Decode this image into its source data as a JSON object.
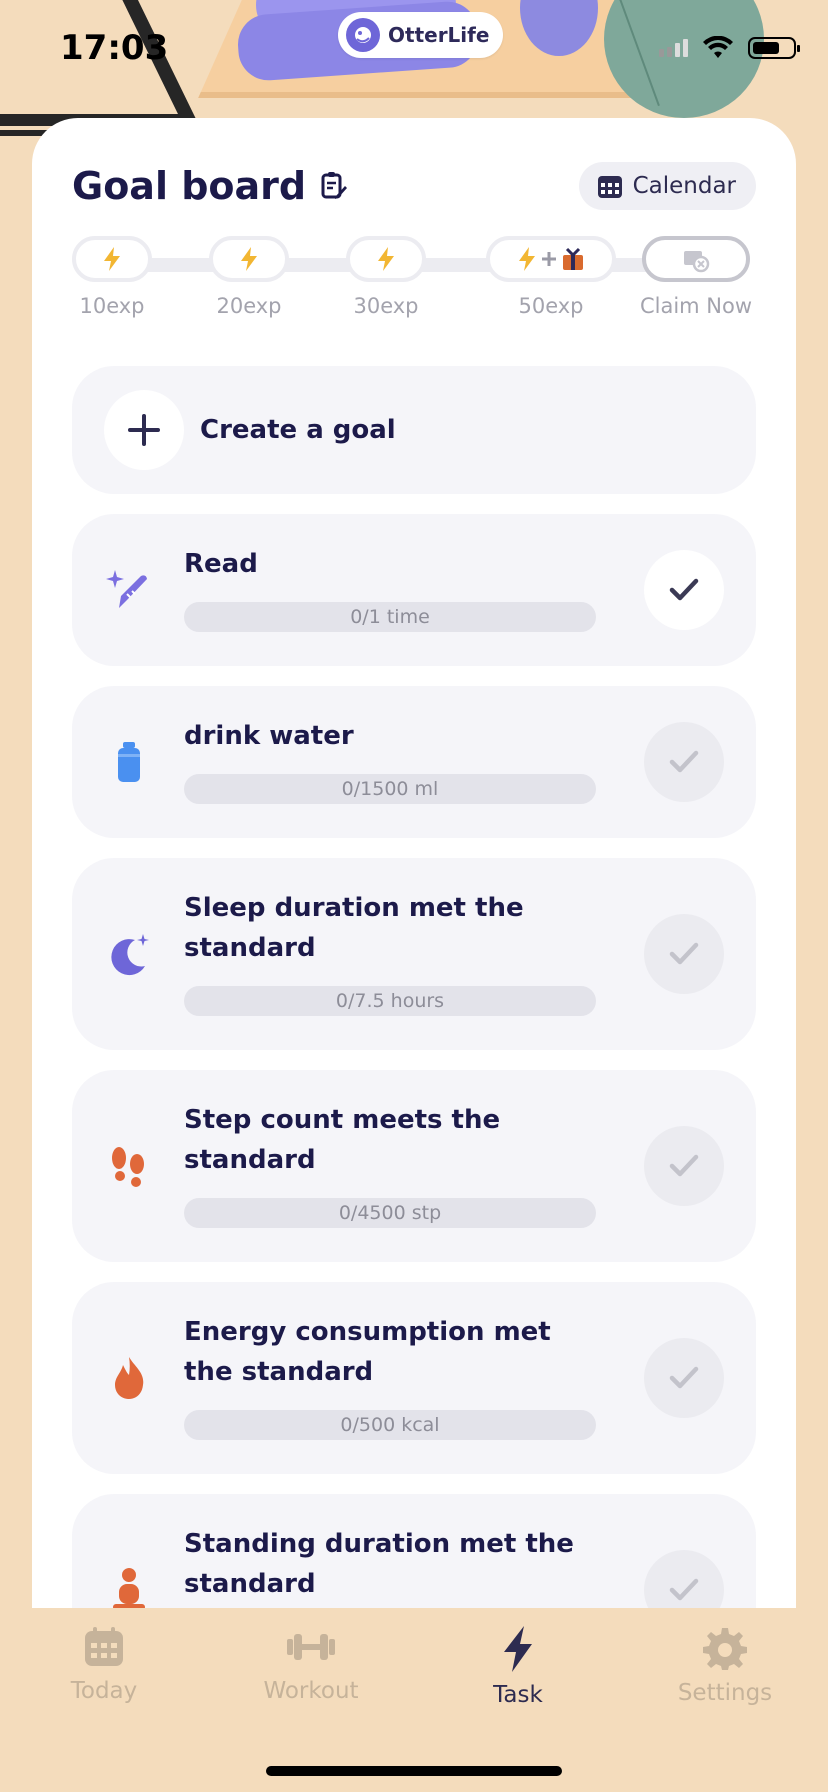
{
  "status_bar": {
    "time": "17:03"
  },
  "brand": {
    "name": "OtterLife"
  },
  "header": {
    "title": "Goal board",
    "calendar_label": "Calendar"
  },
  "exp_track": {
    "milestones": [
      {
        "label": "10exp"
      },
      {
        "label": "20exp"
      },
      {
        "label": "30exp"
      },
      {
        "label": "50exp"
      }
    ],
    "claim_label": "Claim Now"
  },
  "create_goal": {
    "label": "Create a goal"
  },
  "goals": [
    {
      "name": "Read",
      "progress": "0/1 time",
      "done": true,
      "icon": "pen-sparkle-icon"
    },
    {
      "name": "drink water",
      "progress": "0/1500 ml",
      "done": false,
      "icon": "water-bottle-icon"
    },
    {
      "name": "Sleep duration met the standard",
      "progress": "0/7.5 hours",
      "done": false,
      "icon": "moon-icon"
    },
    {
      "name": "Step count meets the standard",
      "progress": "0/4500 stp",
      "done": false,
      "icon": "footprints-icon"
    },
    {
      "name": "Energy consumption met the standard",
      "progress": "0/500 kcal",
      "done": false,
      "icon": "flame-icon"
    },
    {
      "name": "Standing duration met the standard",
      "progress": "",
      "done": false,
      "icon": "standing-person-icon"
    }
  ],
  "tabs": [
    {
      "label": "Today",
      "icon": "calendar-icon",
      "active": false
    },
    {
      "label": "Workout",
      "icon": "dumbbell-icon",
      "active": false
    },
    {
      "label": "Task",
      "icon": "lightning-icon",
      "active": true
    },
    {
      "label": "Settings",
      "icon": "gear-icon",
      "active": false
    }
  ],
  "colors": {
    "background": "#f4dcbc",
    "card": "#ffffff",
    "row": "#f5f5f9",
    "title": "#1c1a4a",
    "accent_purple": "#6e66d8",
    "lightning": "#f2b632",
    "orange": "#e0683a",
    "water_blue": "#4a90f0"
  }
}
